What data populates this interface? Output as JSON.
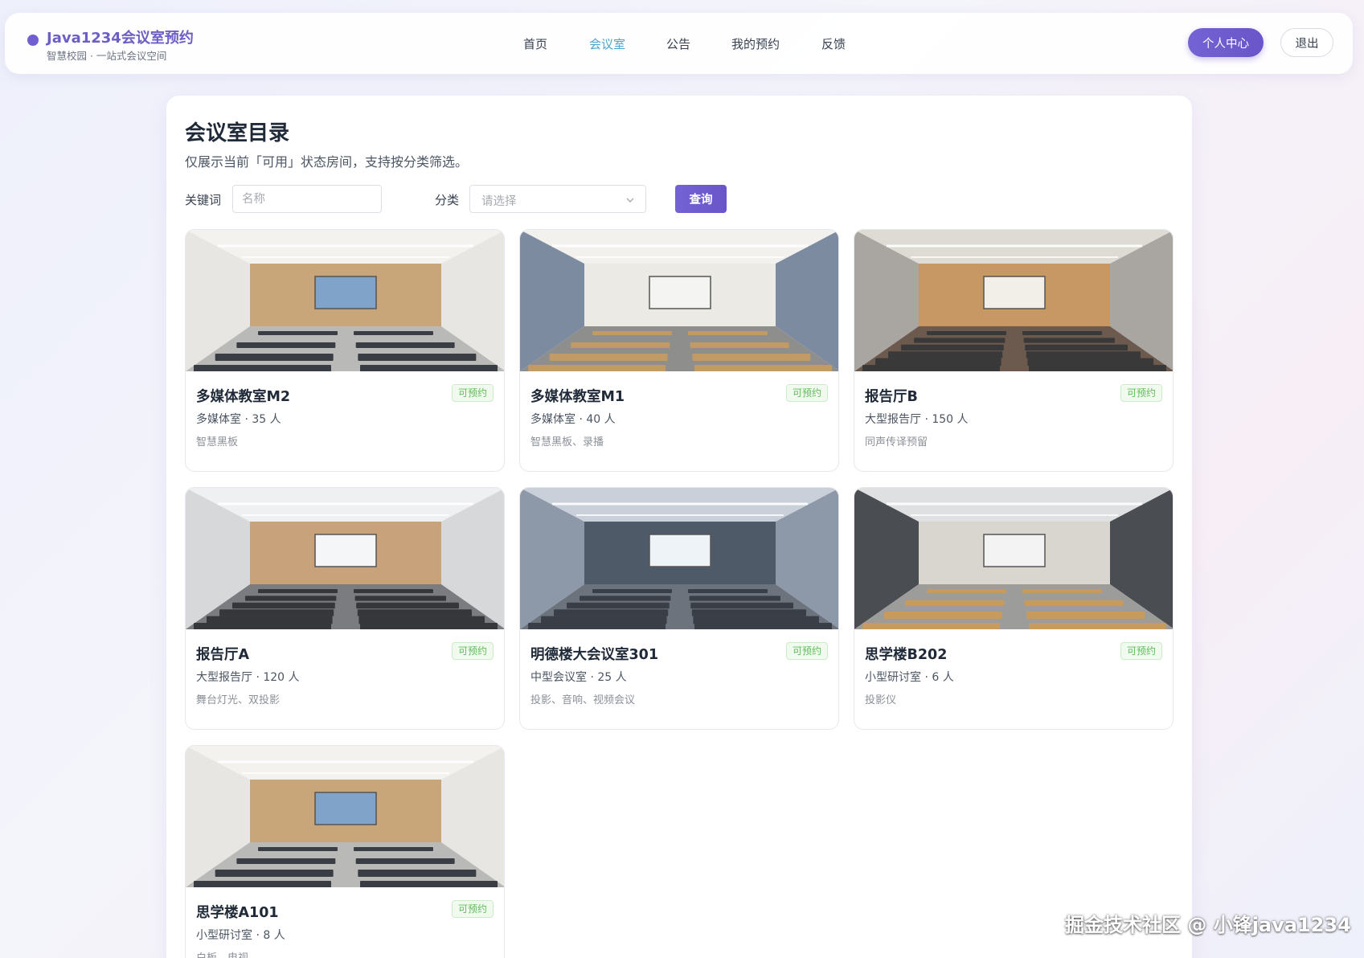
{
  "header": {
    "brand_title": "Java1234会议室预约",
    "brand_sub": "智慧校园 · 一站式会议空间",
    "nav": [
      "首页",
      "会议室",
      "公告",
      "我的预约",
      "反馈"
    ],
    "active_nav": "会议室",
    "btn_center": "个人中心",
    "btn_logout": "退出"
  },
  "main": {
    "title": "会议室目录",
    "subtitle": "仅展示当前「可用」状态房间，支持按分类筛选。",
    "filter": {
      "keyword_label": "关键词",
      "keyword_placeholder": "名称",
      "category_label": "分类",
      "category_placeholder": "请选择",
      "query_button": "查询"
    },
    "rooms": [
      {
        "name": "多媒体教室M2",
        "badge": "可预约",
        "meta": "多媒体室 · 35 人",
        "features": "智慧黑板",
        "image": "classroom-light"
      },
      {
        "name": "多媒体教室M1",
        "badge": "可预约",
        "meta": "多媒体室 · 40 人",
        "features": "智慧黑板、录播",
        "image": "classroom-blue"
      },
      {
        "name": "报告厅B",
        "badge": "可预约",
        "meta": "大型报告厅 · 150 人",
        "features": "同声传译预留",
        "image": "hall-warm"
      },
      {
        "name": "报告厅A",
        "badge": "可预约",
        "meta": "大型报告厅 · 120 人",
        "features": "舞台灯光、双投影",
        "image": "hall-grey"
      },
      {
        "name": "明德楼大会议室301",
        "badge": "可预约",
        "meta": "中型会议室 · 25 人",
        "features": "投影、音响、视频会议",
        "image": "hall-blue"
      },
      {
        "name": "思学楼B202",
        "badge": "可预约",
        "meta": "小型研讨室 · 6 人",
        "features": "投影仪",
        "image": "classroom-dark"
      },
      {
        "name": "思学楼A101",
        "badge": "可预约",
        "meta": "小型研讨室 · 8 人",
        "features": "白板、电视",
        "image": "classroom-light"
      }
    ]
  },
  "watermark": "掘金技术社区 @ 小锋java1234",
  "colors": {
    "accent": "#6c5fc4",
    "nav_active": "#4fa3cf",
    "badge_green": "#5fbf57"
  }
}
